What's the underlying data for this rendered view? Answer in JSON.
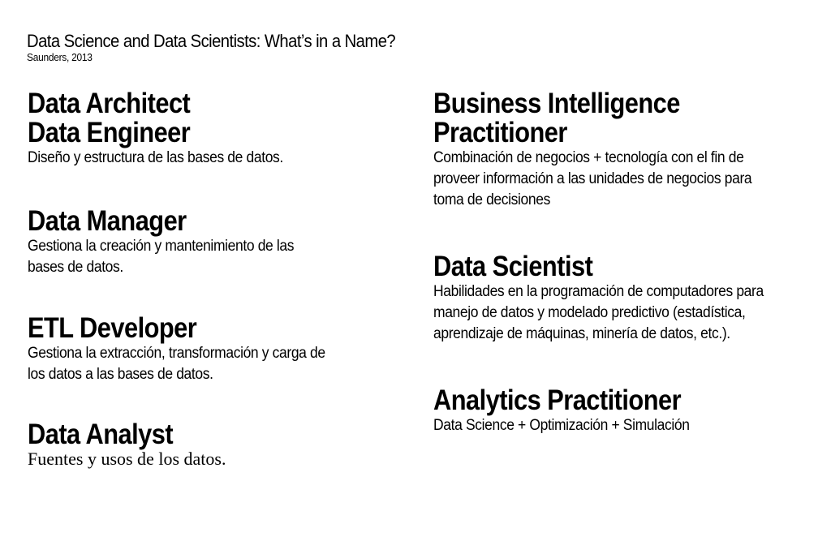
{
  "header": {
    "title": "Data Science and Data Scientists: What’s in a Name?",
    "citation": "Saunders, 2013"
  },
  "left_column": [
    {
      "titles": [
        "Data Architect",
        "Data Engineer"
      ],
      "description": [
        "Diseño y estructura de las bases de datos."
      ]
    },
    {
      "titles": [
        "Data Manager"
      ],
      "description": [
        "Gestiona la creación y mantenimiento de las",
        "bases de datos."
      ]
    },
    {
      "titles": [
        "ETL Developer"
      ],
      "description": [
        "Gestiona la extracción, transformación y carga de",
        "los datos a las bases de datos."
      ]
    },
    {
      "titles": [
        "Data Analyst"
      ],
      "description": [
        "Fuentes y usos de los datos."
      ]
    }
  ],
  "right_column": [
    {
      "titles": [
        "Business Intelligence",
        "Practitioner"
      ],
      "description": [
        "Combinación de negocios + tecnología con el fin de",
        "proveer información a las unidades de negocios para",
        "toma de decisiones"
      ]
    },
    {
      "titles": [
        "Data Scientist"
      ],
      "description": [
        "Habilidades en la programación de computadores para",
        "manejo de datos y modelado predictivo (estadística,",
        "aprendizaje de máquinas, minería de datos, etc.)."
      ]
    },
    {
      "titles": [
        "Analytics Practitioner"
      ],
      "description": [
        "Data Science + Optimización + Simulación"
      ]
    }
  ]
}
